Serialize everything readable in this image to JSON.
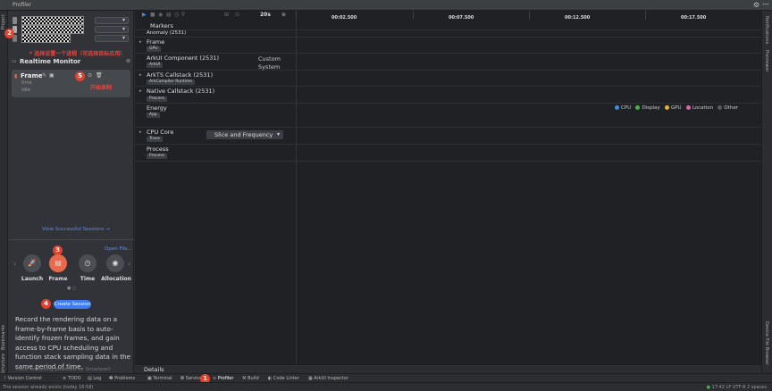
{
  "window": {
    "title": "Profiler"
  },
  "left_strip": {
    "project": "Project",
    "bookmarks": "Bookmarks",
    "structure": "Structure"
  },
  "right_strip": {
    "notifications": "Notifications",
    "previewer": "Previewer",
    "device_file_browser": "Device File Browser"
  },
  "session": {
    "annotation": "* 选择设置一个进程（可选择目标应用）",
    "realtime_monitor": "Realtime Monitor",
    "frame_item": {
      "name": "Frame",
      "duration": "0ms",
      "status": "Idle"
    },
    "start_recording_note": "开始录制"
  },
  "left_bottom": {
    "view_sessions": "View Successful Sessions →",
    "open_file": "Open File...",
    "templates": [
      "Launch",
      "Frame",
      "Time",
      "Allocation"
    ],
    "create_session": "Create Session",
    "description": "Record the rendering data on a frame-by-frame basis to auto-identify frozen frames, and gain access to CPU scheduling and function stack sampling data in the same period of time.",
    "footer": "Trace analysing powered by Smartperf"
  },
  "badges": [
    "1",
    "2",
    "3",
    "4",
    "5"
  ],
  "toolbar": {
    "duration": "20s"
  },
  "timeline": {
    "ticks": [
      "00:02.500",
      "00:07.500",
      "00:12.500",
      "00:17.500"
    ]
  },
  "lanes": [
    {
      "name": "Markers",
      "tag": ""
    },
    {
      "name": "Anomaly (2531)",
      "tag": ""
    },
    {
      "name": "Frame",
      "tag": "GPU"
    },
    {
      "name": "ArkUI Component (2531)",
      "tag": "ArkUI",
      "extra": "Custom",
      "extra2": "System"
    },
    {
      "name": "ArkTS Callstack (2531)",
      "tag": "ArkCompiler Runtime"
    },
    {
      "name": "Native Callstack (2531)",
      "tag": "Process"
    },
    {
      "name": "Energy",
      "tag": "App"
    },
    {
      "name": "CPU Core",
      "tag": "Trace"
    },
    {
      "name": "Process",
      "tag": "Process"
    }
  ],
  "cpu_dropdown": "Slice and Frequency",
  "energy_legend": [
    {
      "name": "CPU",
      "color": "#3b8fd9"
    },
    {
      "name": "Display",
      "color": "#4caf50"
    },
    {
      "name": "GPU",
      "color": "#e0b53a"
    },
    {
      "name": "Location",
      "color": "#d96aa8"
    },
    {
      "name": "Other",
      "color": "#555a60"
    }
  ],
  "details": "Details",
  "bottom_tabs": [
    "Version Control",
    "TODO",
    "Log",
    "Problems",
    "Terminal",
    "Services",
    "Profiler",
    "Build",
    "Code Linter",
    "ArkUI Inspector"
  ],
  "status": {
    "left": "The session already exists (today 16:58)",
    "right": "17:42  LF  UTF-8  2 spaces"
  }
}
